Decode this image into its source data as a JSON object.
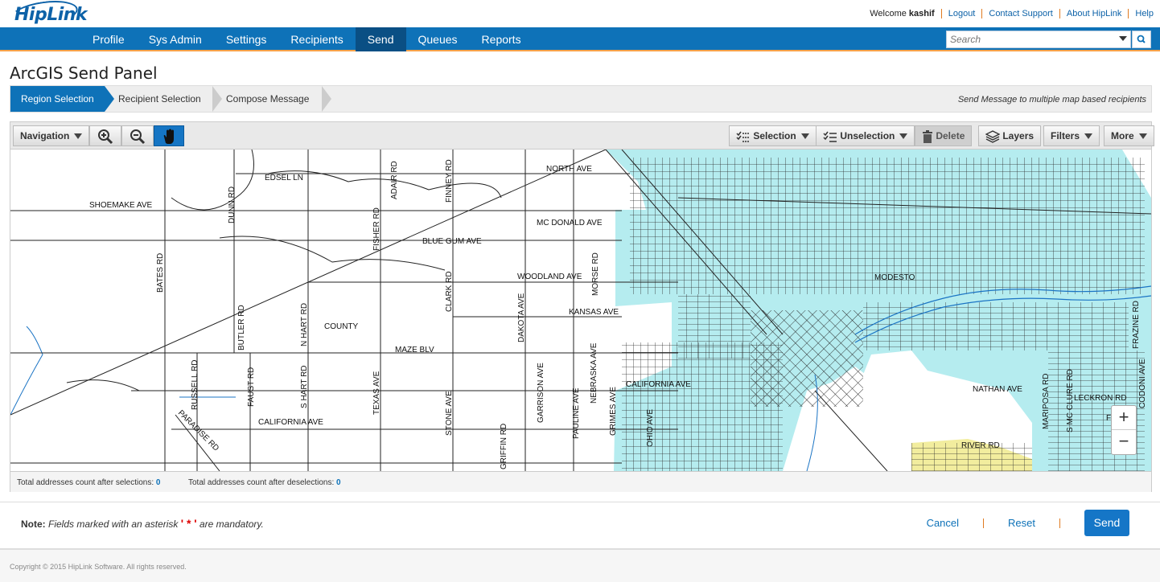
{
  "header": {
    "logo": "HipLink",
    "welcome_prefix": "Welcome",
    "username": "kashif",
    "links": [
      "Logout",
      "Contact Support",
      "About HipLink",
      "Help"
    ],
    "search_placeholder": "Search"
  },
  "nav": {
    "items": [
      "Profile",
      "Sys Admin",
      "Settings",
      "Recipients",
      "Send",
      "Queues",
      "Reports"
    ],
    "active": "Send"
  },
  "page": {
    "title": "ArcGIS Send Panel",
    "steps": [
      "Region Selection",
      "Recipient Selection",
      "Compose Message"
    ],
    "active_step": "Region Selection",
    "wizard_note": "Send Message to multiple map based recipients"
  },
  "toolbar": {
    "navigation": "Navigation",
    "selection": "Selection",
    "unselection": "Unselection",
    "delete": "Delete",
    "layers": "Layers",
    "filters": "Filters",
    "more": "More"
  },
  "map": {
    "street_labels": [
      "EDSEL LN",
      "NORTH AVE",
      "SHOEMAKE AVE",
      "MC DONALD AVE",
      "BLUE GUM AVE",
      "WOODLAND AVE",
      "KANSAS AVE",
      "COUNTY",
      "MAZE BLV",
      "CALIFORNIA AVE",
      "CALIFORNIA AVE",
      "DUNN RD",
      "ADAIR RD",
      "FINNEY RD",
      "FISHER RD",
      "BATES RD",
      "BUTLER RD",
      "N HART RD",
      "CLARK RD",
      "DAKOTA AVE",
      "MORSE RD",
      "RUSSELL RD",
      "FAUST RD",
      "S HART RD",
      "TEXAS AVE",
      "STONE AVE",
      "GRIFFIN RD",
      "GARRISON AVE",
      "PAULINE AVE",
      "NEBRASKA AVE",
      "GRIMES AVE",
      "OHIO AVE",
      "PARADISE RD",
      "MODESTO",
      "NATHAN AVE",
      "LECKRON RD",
      "MARIPOSA RD",
      "S MC CLURE RD",
      "FRAZINE RD",
      "CODONI AVE",
      "FINC",
      "RIVER RD"
    ],
    "zoom_in": "+",
    "zoom_out": "−"
  },
  "counts": {
    "after_selections_label": "Total addresses count after selections:",
    "after_selections_value": "0",
    "after_deselections_label": "Total addresses count after deselections:",
    "after_deselections_value": "0"
  },
  "form": {
    "note_label": "Note:",
    "note_text": "Fields marked with an asterisk",
    "asterisk": "' * '",
    "note_suffix": "are mandatory.",
    "cancel": "Cancel",
    "reset": "Reset",
    "send": "Send"
  },
  "footer": {
    "copyright": "Copyright © 2015 HipLink Software. All rights reserved."
  },
  "colors": {
    "brand_blue": "#0e72b8",
    "accent_orange": "#f7a24a",
    "map_fill": "#b5ecef"
  }
}
